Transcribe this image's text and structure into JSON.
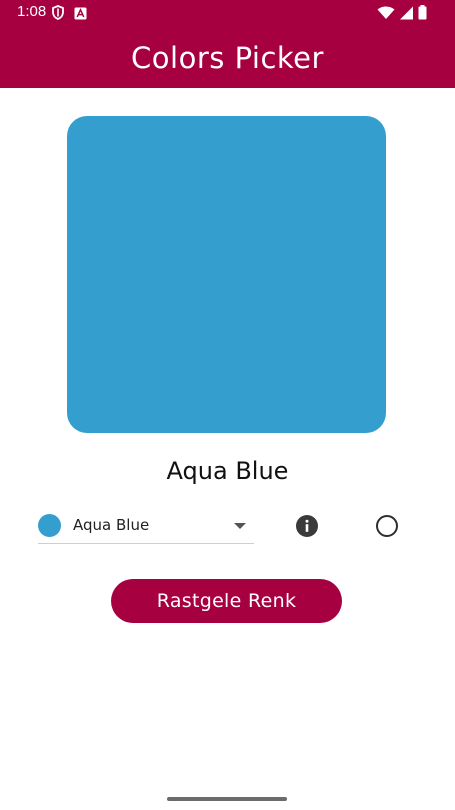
{
  "colors": {
    "brand": "#A70041",
    "selected_swatch": "#349FCF"
  },
  "status_bar": {
    "time": "1:08",
    "icons": [
      "shield-icon",
      "app-notification-icon",
      "wifi-icon",
      "signal-icon",
      "battery-icon"
    ]
  },
  "app_bar": {
    "title": "Colors Picker"
  },
  "main": {
    "selected_color_name": "Aqua Blue",
    "dropdown": {
      "selected_label": "Aqua Blue"
    },
    "random_button_label": "Rastgele Renk"
  }
}
